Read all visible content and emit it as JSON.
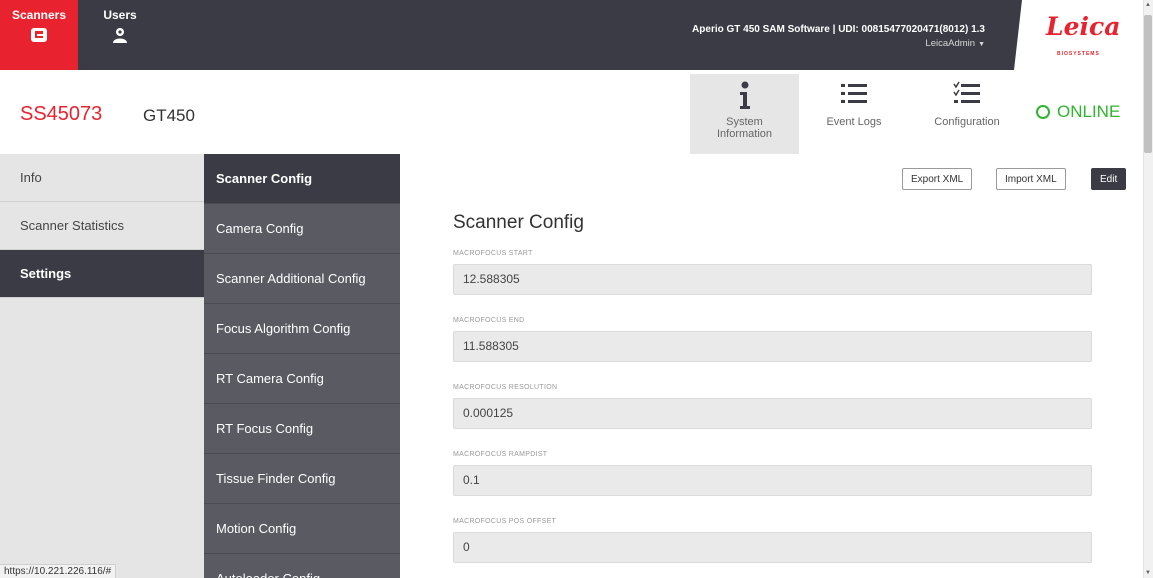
{
  "topnav": {
    "tabs": [
      {
        "label": "Scanners",
        "icon": "scanner-icon"
      },
      {
        "label": "Users",
        "icon": "users-icon"
      }
    ],
    "product_line": "Aperio GT 450 SAM Software | UDI: 00815477020471(8012) 1.3",
    "user": "LeicaAdmin",
    "brand": {
      "name": "Leica",
      "sub": "BIOSYSTEMS"
    }
  },
  "header": {
    "serial": "SS45073",
    "model": "GT450",
    "tabs": [
      {
        "label": "System Information",
        "icon": "info-icon"
      },
      {
        "label": "Event Logs",
        "icon": "list-icon"
      },
      {
        "label": "Configuration",
        "icon": "checklist-icon"
      }
    ],
    "status": "ONLINE"
  },
  "leftnav": {
    "items": [
      "Info",
      "Scanner Statistics",
      "Settings"
    ]
  },
  "subnav": {
    "items": [
      "Scanner Config",
      "Camera Config",
      "Scanner Additional Config",
      "Focus Algorithm Config",
      "RT Camera Config",
      "RT Focus Config",
      "Tissue Finder Config",
      "Motion Config",
      "Autoloader Config"
    ]
  },
  "main": {
    "buttons": {
      "export": "Export XML",
      "import": "Import XML",
      "edit": "Edit"
    },
    "title": "Scanner Config",
    "fields": [
      {
        "label": "MACROFOCUS START",
        "value": "12.588305"
      },
      {
        "label": "MACROFOCUS END",
        "value": "11.588305"
      },
      {
        "label": "MACROFOCUS RESOLUTION",
        "value": "0.000125"
      },
      {
        "label": "MACROFOCUS RAMPDIST",
        "value": "0.1"
      },
      {
        "label": "MACROFOCUS POS OFFSET",
        "value": "0"
      }
    ]
  },
  "status_url": "https://10.221.226.116/#",
  "colors": {
    "brand_red": "#e8232f",
    "dark": "#3b3b45",
    "online_green": "#2fb52f"
  }
}
